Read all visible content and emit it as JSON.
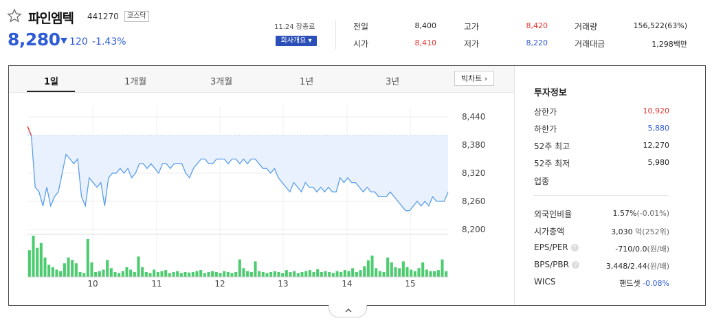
{
  "stock": {
    "name": "파인엠텍",
    "code": "441270",
    "market": "코스닥",
    "price": "8,280",
    "change": "120",
    "rate": "-1.43%",
    "date": "11.24 장종료",
    "company_button": "회사개요 ▾"
  },
  "summary": {
    "prev_label": "전일",
    "prev": "8,400",
    "high_label": "고가",
    "high": "8,420",
    "volume_label": "거래량",
    "volume": "156,522(63%)",
    "open_label": "시가",
    "open": "8,410",
    "low_label": "저가",
    "low": "8,220",
    "amount_label": "거래대금",
    "amount": "1,298백만"
  },
  "tabs": [
    "1일",
    "1개월",
    "3개월",
    "1년",
    "3년"
  ],
  "big_chart_button": "빅차트 ›",
  "invest": {
    "title": "투자정보",
    "rows": [
      {
        "label": "상한가",
        "value": "10,920"
      },
      {
        "label": "하한가",
        "value": "5,880"
      },
      {
        "label": "52주 최고",
        "value": "12,270"
      },
      {
        "label": "52주 최저",
        "value": "5,980"
      },
      {
        "label": "업종",
        "value": ""
      }
    ],
    "foreign_label": "외국인비율",
    "foreign_value": "1.57%",
    "foreign_sub": "(-0.01%)",
    "mcap_label": "시가총액",
    "mcap_value": "3,030",
    "mcap_sub": "억(252위)",
    "eps_label": "EPS/PER",
    "eps_value": "-710/0.0",
    "eps_sub": "(원/배)",
    "bps_label": "BPS/PBR",
    "bps_value": "3,448/2.44",
    "bps_sub": "(원/배)",
    "wics_label": "WICS",
    "wics_value": "핸드셋",
    "wics_sub": "-0.08%"
  },
  "colors": {
    "up": "#e0312d",
    "down": "#2e5bd6",
    "line": "#5a9ee8",
    "fill": "#e8f1fd",
    "volume": "#4ccc6f"
  },
  "chart_data": {
    "type": "line",
    "y_ticks": [
      8440,
      8380,
      8320,
      8260,
      8200
    ],
    "ylim": [
      8200,
      8440
    ],
    "x_ticks": [
      "10",
      "11",
      "12",
      "13",
      "14",
      "15"
    ],
    "prev_close": 8400,
    "price_series": [
      8420,
      8400,
      8290,
      8280,
      8250,
      8290,
      8250,
      8270,
      8280,
      8320,
      8360,
      8350,
      8340,
      8350,
      8270,
      8250,
      8310,
      8300,
      8290,
      8300,
      8250,
      8310,
      8320,
      8320,
      8330,
      8320,
      8330,
      8310,
      8320,
      8340,
      8340,
      8330,
      8340,
      8330,
      8320,
      8340,
      8340,
      8330,
      8340,
      8340,
      8340,
      8320,
      8310,
      8330,
      8340,
      8350,
      8350,
      8340,
      8340,
      8350,
      8350,
      8350,
      8340,
      8350,
      8350,
      8340,
      8350,
      8340,
      8350,
      8350,
      8340,
      8330,
      8330,
      8320,
      8330,
      8310,
      8300,
      8290,
      8280,
      8300,
      8290,
      8280,
      8300,
      8290,
      8290,
      8280,
      8290,
      8280,
      8290,
      8280,
      8280,
      8310,
      8300,
      8310,
      8300,
      8300,
      8290,
      8280,
      8290,
      8280,
      8280,
      8270,
      8270,
      8270,
      8280,
      8270,
      8260,
      8250,
      8240,
      8240,
      8250,
      8260,
      8250,
      8260,
      8250,
      8270,
      8260,
      8260,
      8260,
      8280
    ],
    "volume_series": [
      55,
      85,
      60,
      70,
      40,
      25,
      20,
      15,
      12,
      28,
      40,
      35,
      28,
      10,
      8,
      78,
      30,
      10,
      12,
      15,
      35,
      18,
      10,
      8,
      12,
      20,
      15,
      10,
      42,
      20,
      10,
      8,
      15,
      10,
      12,
      14,
      8,
      10,
      12,
      8,
      10,
      9,
      10,
      12,
      14,
      8,
      10,
      12,
      10,
      8,
      12,
      10,
      8,
      10,
      36,
      18,
      12,
      10,
      32,
      12,
      10,
      8,
      10,
      12,
      10,
      8,
      14,
      10,
      12,
      8,
      10,
      12,
      14,
      10,
      16,
      10,
      12,
      10,
      8,
      12,
      10,
      14,
      12,
      18,
      10,
      14,
      22,
      34,
      44,
      18,
      12,
      10,
      40,
      30,
      20,
      18,
      32,
      20,
      15,
      12,
      18,
      30,
      15,
      12,
      12,
      14,
      36,
      12
    ]
  }
}
